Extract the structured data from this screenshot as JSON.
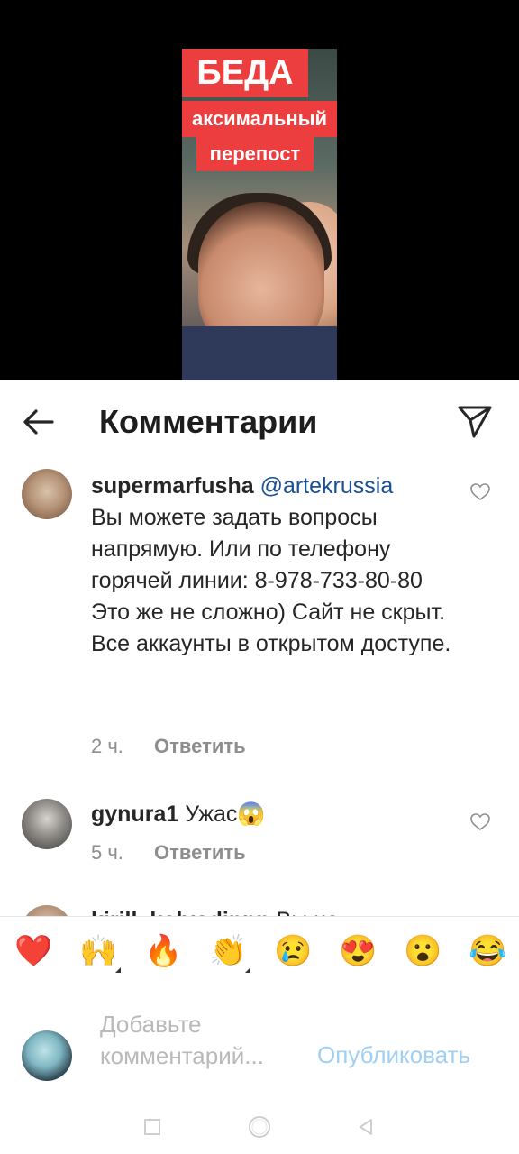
{
  "video": {
    "banner_line1": "БЕДА",
    "banner_line2": "аксимальный",
    "banner_line3": "перепост"
  },
  "header": {
    "title": "Комментарии",
    "back_icon": "arrow-left-icon",
    "send_icon": "paper-plane-icon"
  },
  "comments": [
    {
      "username": "supermarfusha",
      "mention": "@artekrussia",
      "text": "Вы можете задать вопросы напрямую. Или по телефону горячей линии: 8-978-733-80-80  Это же не сложно) Сайт не скрыт. Все аккаунты в открытом доступе.",
      "time": "2 ч.",
      "reply_label": "Ответить"
    },
    {
      "username": "gynura1",
      "text": "Ужас😱",
      "time": "5 ч.",
      "reply_label": "Ответить"
    },
    {
      "username": "kirill_kolvodinpp",
      "text": "Вы не"
    }
  ],
  "emoji_bar": [
    "❤️",
    "🙌",
    "🔥",
    "👏",
    "😢",
    "😍",
    "😮",
    "😂"
  ],
  "composer": {
    "placeholder": "Добавьте комментарий...",
    "publish_label": "Опубликовать"
  },
  "colors": {
    "banner_red": "#ec3e3e",
    "mention_blue": "#1a4f94",
    "publish_blue_disabled": "#9fd0f3",
    "meta_gray": "#8e8e8e"
  }
}
